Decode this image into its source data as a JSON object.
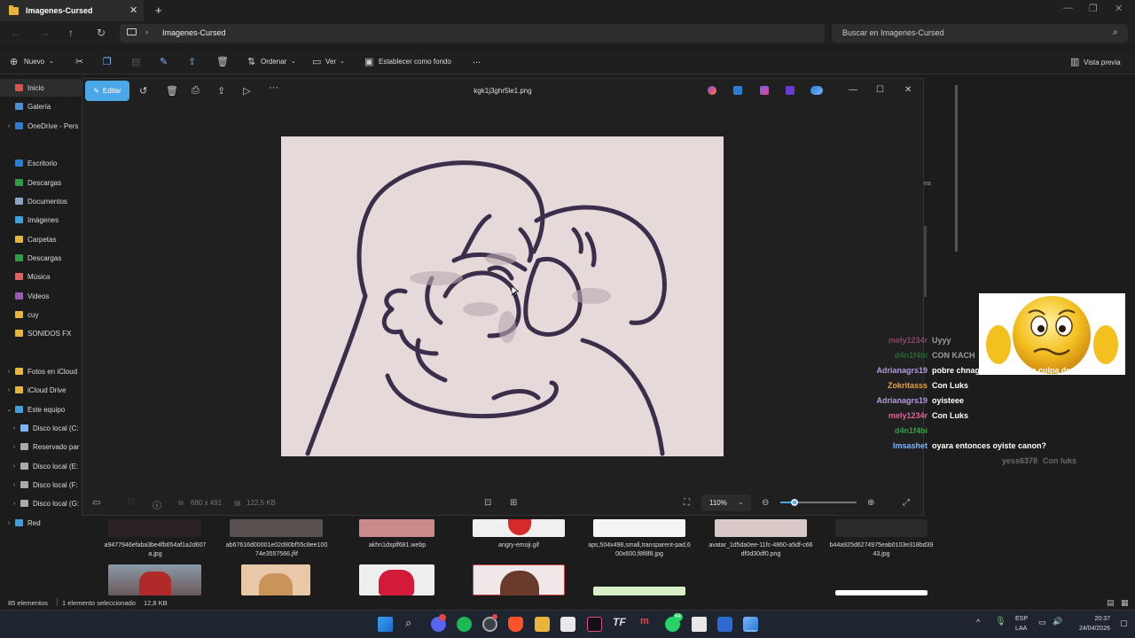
{
  "explorer": {
    "tab_title": "Imagenes-Cursed",
    "address": "Imagenes-Cursed",
    "search_placeholder": "Buscar en Imagenes-Cursed",
    "commands": {
      "new": "Nuevo",
      "sort": "Ordenar",
      "view": "Ver",
      "set_background": "Establecer como fondo",
      "more": "...",
      "preview": "Vista previa"
    },
    "sidebar": [
      {
        "label": "Inicio",
        "icon": "home-icon",
        "color": "#d9534f"
      },
      {
        "label": "Galería",
        "icon": "gallery-icon",
        "color": "#4a90d9"
      },
      {
        "label": "OneDrive - Pers",
        "icon": "cloud-icon",
        "color": "#2b7cd3",
        "chevron": true
      },
      {
        "label": "Escritorio",
        "icon": "desktop-icon",
        "color": "#2b7cd3"
      },
      {
        "label": "Descargas",
        "icon": "download-icon",
        "color": "#2ea043"
      },
      {
        "label": "Documentos",
        "icon": "document-icon",
        "color": "#8aa4c8"
      },
      {
        "label": "Imágenes",
        "icon": "pictures-icon",
        "color": "#3aa0e0"
      },
      {
        "label": "Carpetas",
        "icon": "folder-icon",
        "color": "#e8b43a"
      },
      {
        "label": "Descargas",
        "icon": "download-icon",
        "color": "#2ea043"
      },
      {
        "label": "Música",
        "icon": "music-icon",
        "color": "#e0615b"
      },
      {
        "label": "Videos",
        "icon": "video-icon",
        "color": "#9b59b6"
      },
      {
        "label": "cuy",
        "icon": "folder-icon",
        "color": "#e8b43a"
      },
      {
        "label": "SONIDOS FX",
        "icon": "folder-icon",
        "color": "#e8b43a"
      },
      {
        "label": "Fotos en iCloud",
        "icon": "folder-icon",
        "color": "#e8b43a",
        "chevron": true
      },
      {
        "label": "iCloud Drive",
        "icon": "folder-icon",
        "color": "#e8b43a",
        "chevron": true
      },
      {
        "label": "Este equipo",
        "icon": "pc-icon",
        "color": "#3aa0e0",
        "chevron": true,
        "expanded": true
      },
      {
        "label": "Disco local (C:",
        "icon": "drive-icon",
        "color": "#7ab7ff",
        "chevron": true,
        "indent": true
      },
      {
        "label": "Reservado par",
        "icon": "drive-icon",
        "color": "#aaaaaa",
        "chevron": true,
        "indent": true
      },
      {
        "label": "Disco local (E:",
        "icon": "drive-icon",
        "color": "#aaaaaa",
        "chevron": true,
        "indent": true
      },
      {
        "label": "Disco local (F:",
        "icon": "drive-icon",
        "color": "#aaaaaa",
        "chevron": true,
        "indent": true
      },
      {
        "label": "Disco local (G:",
        "icon": "drive-icon",
        "color": "#aaaaaa",
        "chevron": true,
        "indent": true
      },
      {
        "label": "Red",
        "icon": "network-icon",
        "color": "#3aa0e0",
        "chevron": true
      }
    ],
    "files_row1": [
      "a9477946efaba3be4fb654af1a2d607a.jpg",
      "ab67616d00001e02d80bf55c8ee10074e3557566.jfif",
      "akhn1dxplf681.webp",
      "angry-emoji.gif",
      "aps,504x498,small,transparent-pad,600x600,f8f8f8.jpg",
      "avatar_1d5da0ee-11fc-4860-a5df-c66df0d30df0.png",
      "b44a925d6274975eab0103e318bd3943.jpg"
    ],
    "status": {
      "count": "85 elementos",
      "selected": "1 elemento seleccionado",
      "size": "12,8 KB"
    }
  },
  "viewer": {
    "edit_label": "Editar",
    "filename": "kgk1j3ghr5le1.png",
    "dims": "680 x 491",
    "filesize": "122,5 KB",
    "zoom": "110%",
    "zoom_fraction": 0.19
  },
  "chat": [
    {
      "user": "mely1234r",
      "msg": "Uyyy",
      "color": "#e0619a",
      "faded": true
    },
    {
      "user": "d4n1f4bi",
      "msg": "CON KACH",
      "color": "#2ea043",
      "faded": true
    },
    {
      "user": "Adrianagrs19",
      "msg": "pobre chnaguito no tenía la culpa de nada",
      "color": "#b39ddb"
    },
    {
      "user": "Zokritasss",
      "msg": "Con Luks",
      "color": "#e8a33a"
    },
    {
      "user": "Adrianagrs19",
      "msg": "oyisteee",
      "color": "#b39ddb"
    },
    {
      "user": "mely1234r",
      "msg": "Con Luks",
      "color": "#e0619a"
    },
    {
      "user": "d4n1f4bi",
      "msg": "",
      "color": "#2ea043"
    },
    {
      "user": "Imsashet",
      "msg": "oyara entonces oyiste canon?",
      "color": "#7ab7ff"
    },
    {
      "user": "yess6378",
      "msg": "Con luks",
      "color": "#aaaaaa",
      "faded": true
    }
  ],
  "taskbar": {
    "lang1": "ESP",
    "lang2": "LAA",
    "time": "20:37",
    "date": "24/04/2026",
    "whatsapp_badge": "64"
  }
}
